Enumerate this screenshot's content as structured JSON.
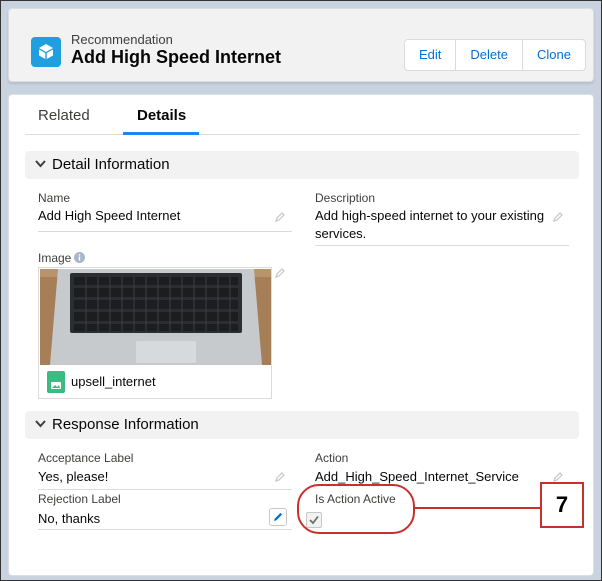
{
  "header": {
    "object_type": "Recommendation",
    "title": "Add High Speed Internet",
    "buttons": {
      "edit": "Edit",
      "delete": "Delete",
      "clone": "Clone"
    }
  },
  "tabs": {
    "related": "Related",
    "details": "Details",
    "active": "Details"
  },
  "sections": {
    "detail": {
      "title": "Detail Information",
      "name_label": "Name",
      "name_value": "Add High Speed Internet",
      "description_label": "Description",
      "description_line1": "Add high-speed internet to your existing",
      "description_line2": "services.",
      "image_label": "Image",
      "image_file": "upsell_internet"
    },
    "response": {
      "title": "Response Information",
      "acceptance_label": "Acceptance Label",
      "acceptance_value": "Yes, please!",
      "action_label": "Action",
      "action_value": "Add_High_Speed_Internet_Service",
      "rejection_label": "Rejection Label",
      "rejection_value": "No, thanks",
      "is_active_label": "Is Action Active",
      "is_active_checked": true
    }
  },
  "callout": {
    "number": "7"
  },
  "colors": {
    "brand_blue": "#0070d2",
    "icon_blue": "#1f9fe0",
    "callout_red": "#c9302c",
    "file_green": "#3bba82"
  }
}
